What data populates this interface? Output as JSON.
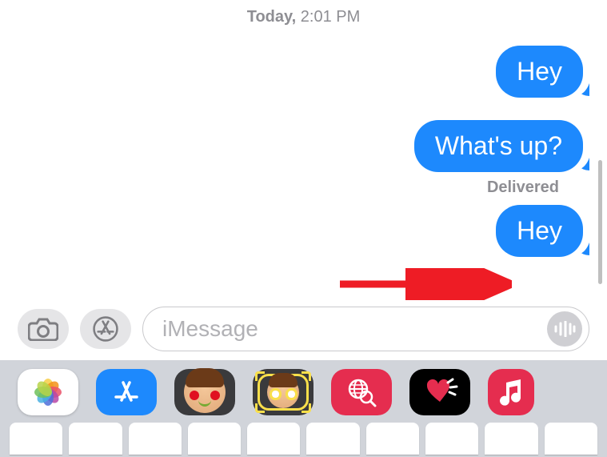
{
  "timestamp": {
    "day": "Today,",
    "time": "2:01 PM"
  },
  "messages": [
    {
      "text": "Hey",
      "tail": true
    },
    {
      "text": "What's up?",
      "tail": true
    },
    {
      "text": "Hey",
      "tail": true
    }
  ],
  "status": "Delivered",
  "input": {
    "placeholder": "iMessage"
  },
  "colors": {
    "bubble": "#1d89fd",
    "arrow": "#ee1c25"
  },
  "app_strip": [
    {
      "name": "photos",
      "bg": "#ffffff"
    },
    {
      "name": "app-store",
      "bg": "#1d89fd"
    },
    {
      "name": "memoji-hearts",
      "bg": "#3a3a3c"
    },
    {
      "name": "memoji-stickers",
      "bg": "#3a3a3c"
    },
    {
      "name": "find-images",
      "bg": "#e52d4f"
    },
    {
      "name": "digital-touch",
      "bg": "#000000"
    },
    {
      "name": "apple-music",
      "bg": "#e52d4f"
    }
  ]
}
